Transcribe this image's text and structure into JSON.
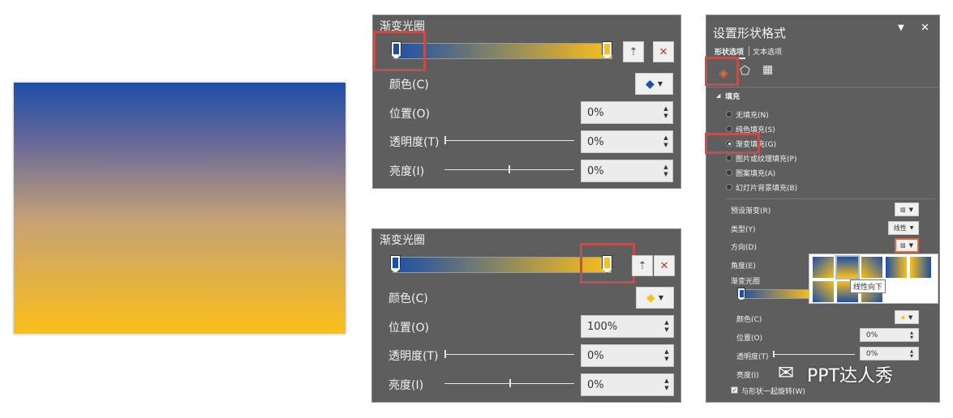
{
  "colors": {
    "gradient_start": "#1d4fa8",
    "gradient_end": "#fbbf1a",
    "panel_bg": "#5e5e5e",
    "highlight": "#c0504d"
  },
  "panel_top": {
    "title": "渐变光圈",
    "color_label": "颜色(C)",
    "position_label": "位置(O)",
    "position_value": "0%",
    "transparency_label": "透明度(T)",
    "transparency_value": "0%",
    "brightness_label": "亮度(I)",
    "brightness_value": "0%",
    "selected_stop": "blue"
  },
  "panel_bottom": {
    "title": "渐变光圈",
    "color_label": "颜色(C)",
    "position_label": "位置(O)",
    "position_value": "100%",
    "transparency_label": "透明度(T)",
    "transparency_value": "0%",
    "brightness_label": "亮度(I)",
    "brightness_value": "0%",
    "selected_stop": "yellow"
  },
  "format_pane": {
    "title": "设置形状格式",
    "tab_shape": "形状选项",
    "tab_text": "文本选项",
    "section_fill": "填充",
    "fill_options": [
      "无填充(N)",
      "纯色填充(S)",
      "渐变填充(G)",
      "图片或纹理填充(P)",
      "图案填充(A)",
      "幻灯片背景填充(B)"
    ],
    "selected_fill": "渐变填充(G)",
    "preset_label": "预设渐变(R)",
    "type_label": "类型(Y)",
    "type_value": "线性",
    "direction_label": "方向(D)",
    "angle_label": "角度(E)",
    "stops_label": "渐变光圈",
    "color_label": "颜色(C)",
    "position_label": "位置(O)",
    "position_value": "0%",
    "transparency_label": "透明度(T)",
    "transparency_value": "0%",
    "brightness_label": "亮度(I)",
    "rotate_label": "与形状一起旋转(W)",
    "tooltip": "线性向下"
  },
  "watermark": {
    "text": "PPT达人秀"
  }
}
